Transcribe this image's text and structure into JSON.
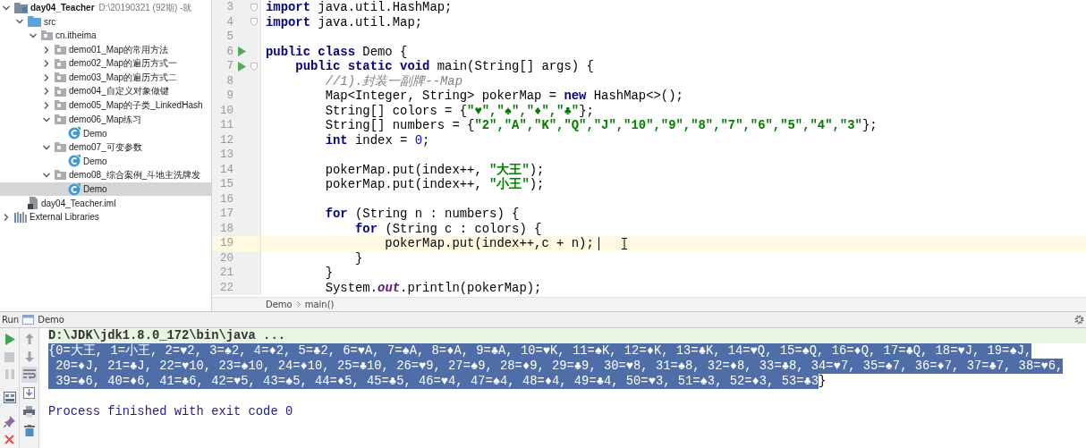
{
  "project_tree": [
    {
      "label": "day04_Teacher",
      "detail": "D:\\20190321 (92期) -就",
      "kind": "module",
      "expanded": true,
      "selected": false,
      "children": [
        {
          "label": "src",
          "kind": "source-folder",
          "expanded": true,
          "selected": false,
          "children": [
            {
              "label": "cn.itheima",
              "kind": "package",
              "expanded": true,
              "selected": false,
              "children": [
                {
                  "label": "demo01_Map的常用方法",
                  "kind": "package",
                  "expanded": false,
                  "selected": false
                },
                {
                  "label": "demo02_Map的遍历方式一",
                  "kind": "package",
                  "expanded": false,
                  "selected": false
                },
                {
                  "label": "demo03_Map的遍历方式二",
                  "kind": "package",
                  "expanded": false,
                  "selected": false
                },
                {
                  "label": "demo04_自定义对象做键",
                  "kind": "package",
                  "expanded": false,
                  "selected": false
                },
                {
                  "label": "demo05_Map的子类_LinkedHash",
                  "kind": "package",
                  "expanded": false,
                  "selected": false
                },
                {
                  "label": "demo06_Map练习",
                  "kind": "package",
                  "expanded": true,
                  "selected": false,
                  "children": [
                    {
                      "label": "Demo",
                      "kind": "class",
                      "selected": false
                    }
                  ]
                },
                {
                  "label": "demo07_可变参数",
                  "kind": "package",
                  "expanded": true,
                  "selected": false,
                  "children": [
                    {
                      "label": "Demo",
                      "kind": "class",
                      "selected": false
                    }
                  ]
                },
                {
                  "label": "demo08_综合案例_斗地主洗牌发",
                  "kind": "package",
                  "expanded": true,
                  "selected": false,
                  "children": [
                    {
                      "label": "Demo",
                      "kind": "class",
                      "selected": true
                    }
                  ]
                }
              ]
            }
          ]
        },
        {
          "label": "day04_Teacher.iml",
          "kind": "iml-file",
          "selected": false
        }
      ]
    },
    {
      "label": "External Libraries",
      "kind": "library",
      "expanded": false,
      "selected": false
    }
  ],
  "editor": {
    "lines": [
      {
        "number": "3",
        "fold": true,
        "tokens": [
          {
            "kind": "keyword",
            "text": "import"
          },
          {
            "kind": "plain",
            "text": " java.util.HashMap;"
          }
        ]
      },
      {
        "number": "4",
        "fold": true,
        "tokens": [
          {
            "kind": "keyword",
            "text": "import"
          },
          {
            "kind": "plain",
            "text": " java.util.Map;"
          }
        ]
      },
      {
        "number": "5"
      },
      {
        "number": "6",
        "run": true,
        "tokens": [
          {
            "kind": "keyword",
            "text": "public class"
          },
          {
            "kind": "plain",
            "text": " Demo {"
          }
        ]
      },
      {
        "number": "7",
        "run": true,
        "fold": true,
        "tokens": [
          {
            "kind": "keyword",
            "text": "    public static void"
          },
          {
            "kind": "plain",
            "text": " main(String[] args) {"
          }
        ]
      },
      {
        "number": "8",
        "tokens": [
          {
            "kind": "comment",
            "text": "        //1).封装一副牌--Map"
          }
        ]
      },
      {
        "number": "9",
        "tokens": [
          {
            "kind": "plain",
            "text": "        Map<Integer, String> pokerMap = "
          },
          {
            "kind": "keyword",
            "text": "new"
          },
          {
            "kind": "plain",
            "text": " HashMap<>();"
          }
        ]
      },
      {
        "number": "10",
        "tokens": [
          {
            "kind": "plain",
            "text": "        String[] colors = {"
          },
          {
            "kind": "string",
            "text": "\"♥\",\"♠\",\"♦\",\"♣\""
          },
          {
            "kind": "plain",
            "text": "};"
          }
        ]
      },
      {
        "number": "11",
        "tokens": [
          {
            "kind": "plain",
            "text": "        String[] numbers = {"
          },
          {
            "kind": "string",
            "text": "\"2\",\"A\",\"K\",\"Q\",\"J\",\"10\",\"9\",\"8\",\"7\",\"6\",\"5\",\"4\",\"3\""
          },
          {
            "kind": "plain",
            "text": "};"
          }
        ]
      },
      {
        "number": "12",
        "tokens": [
          {
            "kind": "keyword",
            "text": "        int"
          },
          {
            "kind": "plain",
            "text": " index = "
          },
          {
            "kind": "number",
            "text": "0"
          },
          {
            "kind": "plain",
            "text": ";"
          }
        ]
      },
      {
        "number": "13"
      },
      {
        "number": "14",
        "tokens": [
          {
            "kind": "plain",
            "text": "        pokerMap.put(index++, "
          },
          {
            "kind": "string",
            "text": "\"大王\""
          },
          {
            "kind": "plain",
            "text": ");"
          }
        ]
      },
      {
        "number": "15",
        "tokens": [
          {
            "kind": "plain",
            "text": "        pokerMap.put(index++, "
          },
          {
            "kind": "string",
            "text": "\"小王\""
          },
          {
            "kind": "plain",
            "text": ");"
          }
        ]
      },
      {
        "number": "16"
      },
      {
        "number": "17",
        "tokens": [
          {
            "kind": "keyword",
            "text": "        for"
          },
          {
            "kind": "plain",
            "text": " (String n : numbers) {"
          }
        ]
      },
      {
        "number": "18",
        "tokens": [
          {
            "kind": "keyword",
            "text": "            for"
          },
          {
            "kind": "plain",
            "text": " (String c : colors) {"
          }
        ]
      },
      {
        "number": "19",
        "current": true,
        "tokens": [
          {
            "kind": "plain",
            "text": "                pokerMap.put(index++,c + n);"
          }
        ]
      },
      {
        "number": "20",
        "tokens": [
          {
            "kind": "plain",
            "text": "            }"
          }
        ]
      },
      {
        "number": "21",
        "tokens": [
          {
            "kind": "plain",
            "text": "        }"
          }
        ]
      },
      {
        "number": "22",
        "tokens": [
          {
            "kind": "plain",
            "text": "        System."
          },
          {
            "kind": "field",
            "text": "out"
          },
          {
            "kind": "plain",
            "text": ".println(pokerMap);"
          }
        ]
      }
    ],
    "breadcrumbs": [
      "Demo",
      "main()"
    ]
  },
  "run_panel": {
    "label": "Run",
    "tab": "Demo",
    "run_tools": [
      {
        "kind": "rerun"
      },
      {
        "kind": "stop"
      },
      {
        "kind": "pause"
      },
      {
        "kind": "layout"
      },
      {
        "kind": "pin"
      },
      {
        "kind": "close"
      }
    ],
    "console_tools": [
      {
        "kind": "up"
      },
      {
        "kind": "down"
      },
      {
        "kind": "soft-wrap",
        "on": true
      },
      {
        "kind": "scroll-end"
      },
      {
        "kind": "print"
      },
      {
        "kind": "trash"
      }
    ],
    "console": [
      {
        "kind": "command",
        "segments": [
          {
            "text": "D:\\JDK\\jdk1.8.0_172\\bin\\java ...",
            "selected": false
          }
        ]
      },
      {
        "kind": "output",
        "segments": [
          {
            "text": "{0=大王, 1=小王, 2=♥2, 3=♠2, 4=♦2, 5=♣2, 6=♥A, 7=♠A, 8=♦A, 9=♣A, 10=♥K, 11=♠K, 12=♦K, 13=♣K, 14=♥Q, 15=♠Q, 16=♦Q, 17=♣Q, 18=♥J, 19=♠J,",
            "selected": true
          }
        ]
      },
      {
        "kind": "output",
        "segments": [
          {
            "text": " 20=♦J, 21=♣J, 22=♥10, 23=♠10, 24=♦10, 25=♣10, 26=♥9, 27=♠9, 28=♦9, 29=♣9, 30=♥8, 31=♠8, 32=♦8, 33=♣8, 34=♥7, 35=♠7, 36=♦7, 37=♣7, 38=♥6,",
            "selected": true
          }
        ]
      },
      {
        "kind": "output",
        "segments": [
          {
            "text": " 39=♠6, 40=♦6, 41=♣6, 42=♥5, 43=♠5, 44=♦5, 45=♣5, 46=♥4, 47=♠4, 48=♦4, 49=♣4, 50=♥3, 51=♠3, 52=♦3, 53=♣3",
            "selected": true
          },
          {
            "text": "}",
            "selected": false
          }
        ]
      },
      {
        "kind": "blank"
      },
      {
        "kind": "status",
        "segments": [
          {
            "text": "Process finished with exit code 0",
            "selected": false
          }
        ]
      }
    ]
  }
}
